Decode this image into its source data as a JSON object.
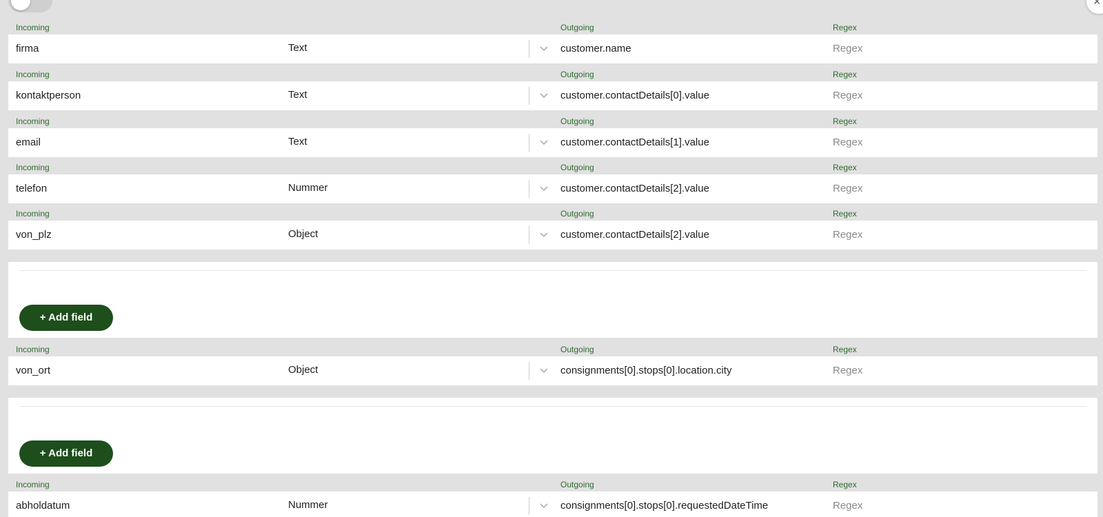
{
  "close_icon_glyph": "×",
  "labels": {
    "incoming": "Incoming",
    "outgoing": "Outgoing",
    "regex": "Regex"
  },
  "mappings": [
    {
      "incoming": "firma",
      "type": "Text",
      "outgoing": "customer.name",
      "regex_placeholder": "Regex"
    },
    {
      "incoming": "kontaktperson",
      "type": "Text",
      "outgoing": "customer.contactDetails[0].value",
      "regex_placeholder": "Regex"
    },
    {
      "incoming": "email",
      "type": "Text",
      "outgoing": "customer.contactDetails[1].value",
      "regex_placeholder": "Regex"
    },
    {
      "incoming": "telefon",
      "type": "Nummer",
      "outgoing": "customer.contactDetails[2].value",
      "regex_placeholder": "Regex"
    },
    {
      "incoming": "von_plz",
      "type": "Object",
      "outgoing": "customer.contactDetails[2].value",
      "regex_placeholder": "Regex"
    },
    {
      "incoming": "von_ort",
      "type": "Object",
      "outgoing": "consignments[0].stops[0].location.city",
      "regex_placeholder": "Regex"
    },
    {
      "incoming": "abholdatum",
      "type": "Nummer",
      "outgoing": "consignments[0].stops[0].requestedDateTime",
      "regex_placeholder": "Regex"
    }
  ],
  "add_field_label": "+ Add field",
  "colors": {
    "label_green": "#2e6b2e",
    "button_green": "#1e4e1c",
    "background": "#e1e1e1"
  }
}
